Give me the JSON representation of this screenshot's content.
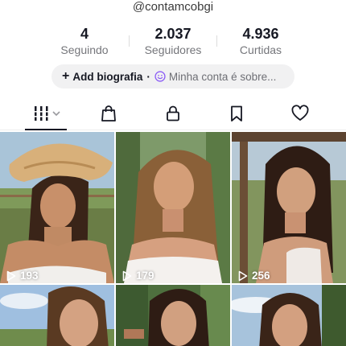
{
  "profile": {
    "username": "@contamcobgi"
  },
  "stats": [
    {
      "value": "4",
      "label": "Seguindo"
    },
    {
      "value": "2.037",
      "label": "Seguidores"
    },
    {
      "value": "4.936",
      "label": "Curtidas"
    }
  ],
  "bio": {
    "add_label": "Add biografia",
    "separator": "·",
    "hint": "Minha conta é sobre..."
  },
  "tabs": {
    "active": "videos-grid",
    "icons": [
      "grid-icon",
      "shopping-bag-icon",
      "lock-icon",
      "bookmark-icon",
      "heart-icon"
    ]
  },
  "videos": [
    {
      "views": "193"
    },
    {
      "views": "179"
    },
    {
      "views": "256"
    },
    {
      "views": ""
    },
    {
      "views": ""
    },
    {
      "views": ""
    }
  ],
  "colors": {
    "text": "#161823",
    "muted": "#75767b",
    "pill": "#f1f1f2"
  }
}
